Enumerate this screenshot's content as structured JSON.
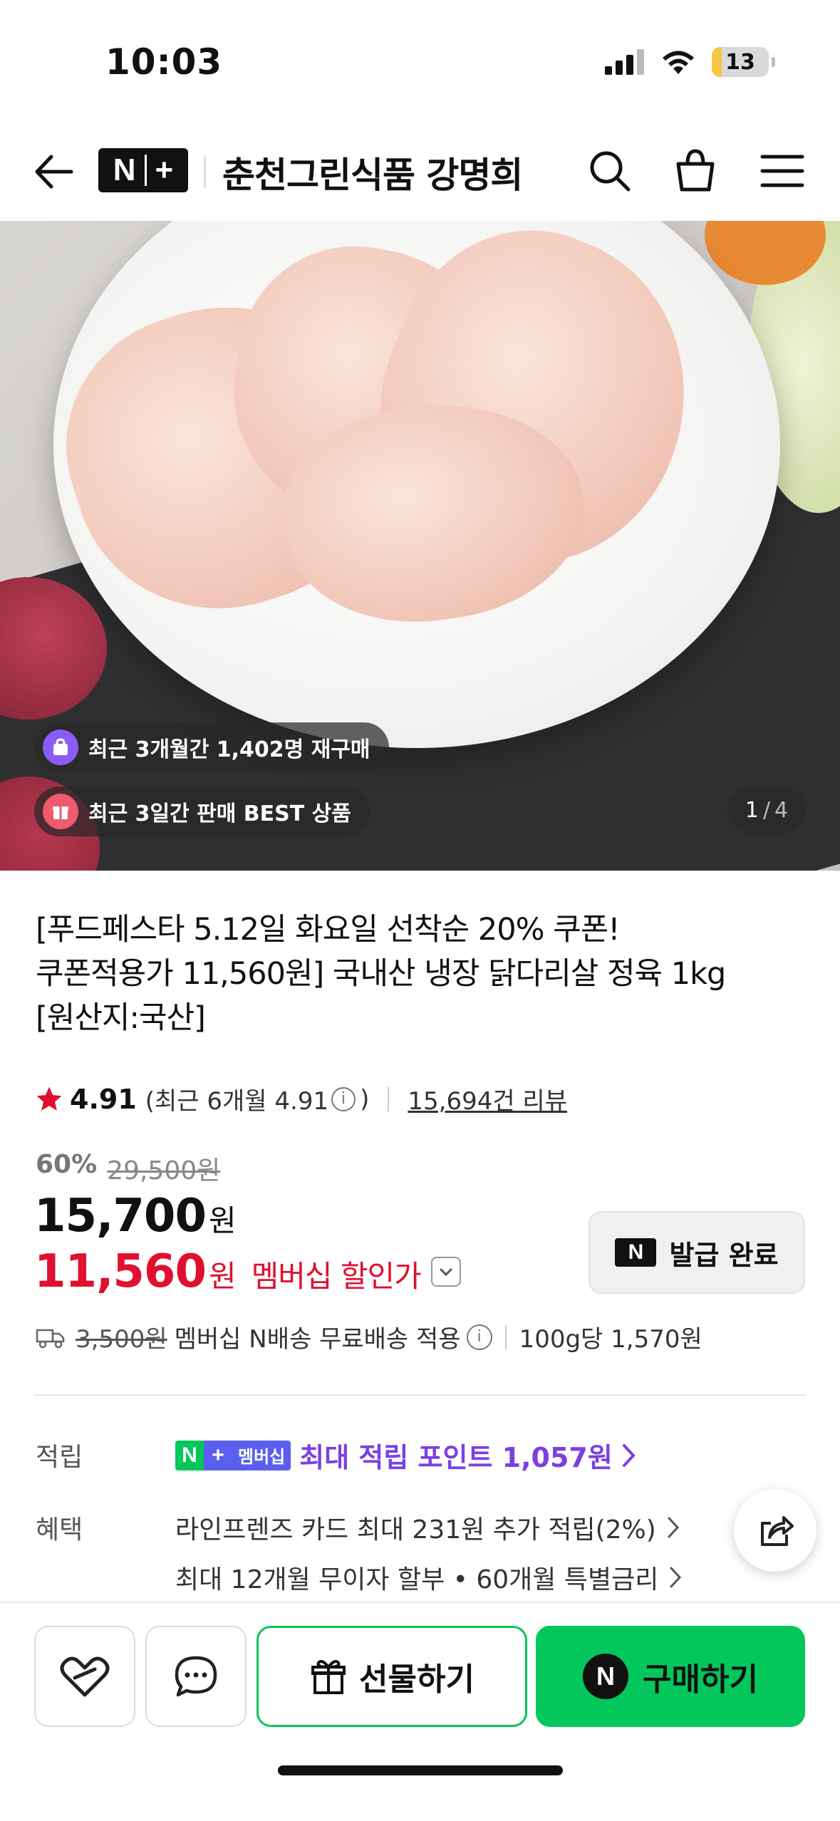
{
  "status": {
    "time": "10:03",
    "battery": "13"
  },
  "header": {
    "logo": "N+",
    "title": "춘천그린식품 강명희"
  },
  "hero": {
    "badge_repurchase": "최근 3개월간 1,402명 재구매",
    "badge_best": "최근 3일간 판매 BEST 상품",
    "page_current": "1",
    "page_sep": "/",
    "page_total": "4"
  },
  "product": {
    "title_line1": "[푸드페스타 5.12일 화요일 선착순 20% 쿠폰!",
    "title_line2": "쿠폰적용가 11,560원] 국내산 냉장 닭다리살 정육 1kg",
    "title_line3": "[원산지:국산]",
    "rating": "4.91",
    "rating_recent": "(최근 6개월 4.91",
    "rating_recent_close": ")",
    "reviews": "15,694건 리뷰",
    "discount_rate": "60%",
    "original_price": "29,500원",
    "price": "15,700",
    "price_unit": "원",
    "member_price": "11,560",
    "member_price_unit": "원",
    "member_label": "멤버십 할인가",
    "coupon_label": "발급 완료",
    "shipping_old": "3,500원",
    "shipping_text": "멤버십 N배송 무료배송 적용",
    "unit_price": "100g당 1,570원"
  },
  "benefits": {
    "points_label": "적립",
    "membership_tag": "멤버십",
    "points_text": "최대 적립 포인트 1,057원",
    "benefit_label": "혜택",
    "card_text": "라인프렌즈 카드 최대 231원 추가 적립(2%)",
    "installment_text": "최대 12개월 무이자 할부 • 60개월 특별금리"
  },
  "bottom": {
    "gift_label": "선물하기",
    "buy_label": "구매하기"
  },
  "colors": {
    "accent_green": "#03c75a",
    "sale_red": "#e0102f",
    "points_purple": "#7b3fe4"
  }
}
